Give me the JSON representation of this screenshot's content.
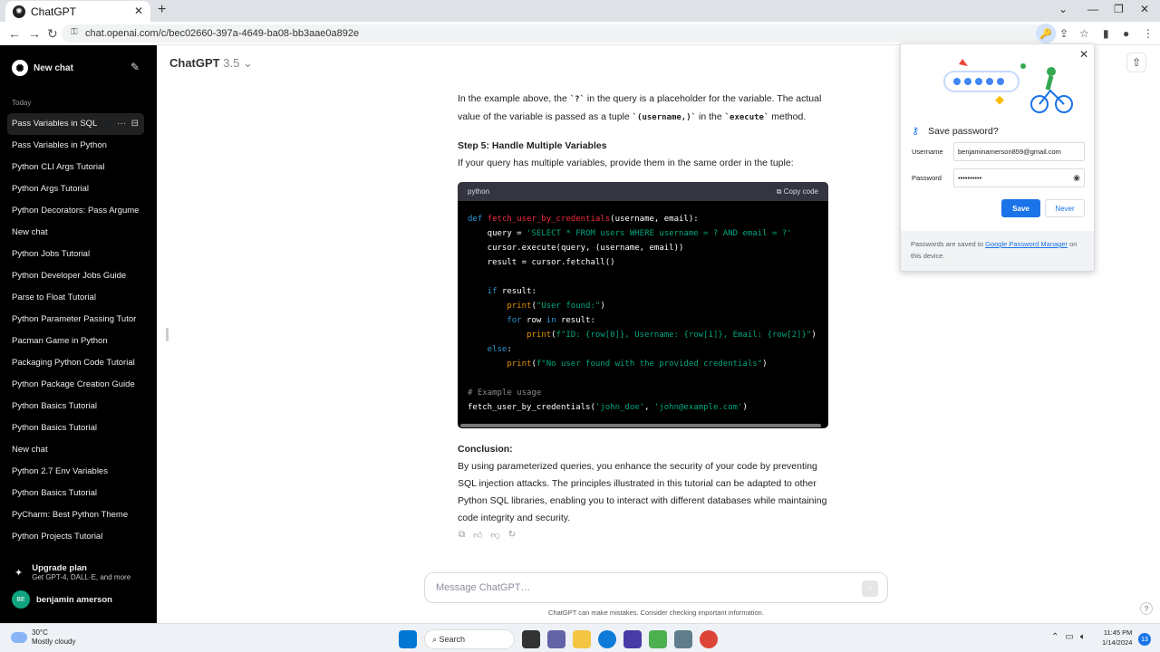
{
  "browser": {
    "tab_title": "ChatGPT",
    "url": "chat.openai.com/c/bec02660-397a-4649-ba08-bb3aae0a892e"
  },
  "sidebar": {
    "new_chat": "New chat",
    "section_today": "Today",
    "items": [
      {
        "label": "Pass Variables in SQL"
      },
      {
        "label": "Pass Variables in Python"
      },
      {
        "label": "Python CLI Args Tutorial"
      },
      {
        "label": "Python Args Tutorial"
      },
      {
        "label": "Python Decorators: Pass Argume"
      },
      {
        "label": "New chat"
      },
      {
        "label": "Python Jobs Tutorial"
      },
      {
        "label": "Python Developer Jobs Guide"
      },
      {
        "label": "Parse to Float Tutorial"
      },
      {
        "label": "Python Parameter Passing Tutor"
      },
      {
        "label": "Pacman Game in Python"
      },
      {
        "label": "Packaging Python Code Tutorial"
      },
      {
        "label": "Python Package Creation Guide"
      },
      {
        "label": "Python Basics Tutorial"
      },
      {
        "label": "Python Basics Tutorial"
      },
      {
        "label": "New chat"
      },
      {
        "label": "Python 2.7 Env Variables"
      },
      {
        "label": "Python Basics Tutorial"
      },
      {
        "label": "PyCharm: Best Python Theme"
      },
      {
        "label": "Python Projects Tutorial"
      }
    ],
    "upgrade_title": "Upgrade plan",
    "upgrade_sub": "Get GPT-4, DALL·E, and more",
    "user_initials": "BE",
    "user_name": "benjamin amerson"
  },
  "header": {
    "model": "ChatGPT",
    "version": "3.5"
  },
  "message": {
    "para1_a": "In the example above, the ",
    "para1_code1": "`?`",
    "para1_b": " in the query is a placeholder for the variable. The actual value of the variable is passed as a tuple ",
    "para1_code2": "`(username,)`",
    "para1_c": " in the ",
    "para1_code3": "`execute`",
    "para1_d": " method.",
    "step5_title": "Step 5: Handle Multiple Variables",
    "step5_text": "If your query has multiple variables, provide them in the same order in the tuple:",
    "code_lang": "python",
    "copy_label": "Copy code",
    "conclusion_title": "Conclusion:",
    "conclusion_text": "By using parameterized queries, you enhance the security of your code by preventing SQL injection attacks. The principles illustrated in this tutorial can be adapted to other Python SQL libraries, enabling you to interact with different databases while maintaining code integrity and security."
  },
  "code": {
    "l1_def": "def ",
    "l1_fn": "fetch_user_by_credentials",
    "l1_rest": "(username, email):",
    "l2_a": "    query = ",
    "l2_s": "'SELECT * FROM users WHERE username = ? AND email = ?'",
    "l3": "    cursor.execute(query, (username, email))",
    "l4": "    result = cursor.fetchall()",
    "l6_kw": "    if",
    "l6_rest": " result:",
    "l7_bi": "        print",
    "l7_a": "(",
    "l7_s": "\"User found:\"",
    "l7_b": ")",
    "l8_kw1": "        for",
    "l8_a": " row ",
    "l8_kw2": "in",
    "l8_b": " result:",
    "l9_bi": "            print",
    "l9_a": "(",
    "l9_s": "f\"ID: {row[0]}, Username: {row[1]}, Email: {row[2]}\"",
    "l9_b": ")",
    "l10_kw": "    else",
    "l10_rest": ":",
    "l11_bi": "        print",
    "l11_a": "(",
    "l11_s": "f\"No user found with the provided credentials\"",
    "l11_b": ")",
    "l13_cm": "# Example usage",
    "l14_a": "fetch_user_by_credentials(",
    "l14_s1": "'john_doe'",
    "l14_b": ", ",
    "l14_s2": "'john@example.com'",
    "l14_c": ")"
  },
  "composer": {
    "placeholder": "Message ChatGPT…",
    "disclaimer": "ChatGPT can make mistakes. Consider checking important information."
  },
  "password_popup": {
    "title": "Save password?",
    "username_label": "Username",
    "username_value": "benjaminamerson859@gmail.com",
    "password_label": "Password",
    "password_value": "••••••••••",
    "save": "Save",
    "never": "Never",
    "footer_a": "Passwords are saved to ",
    "footer_link": "Google Password Manager",
    "footer_b": " on this device."
  },
  "taskbar": {
    "temp": "30°C",
    "weather": "Mostly cloudy",
    "search": "Search",
    "time": "11:45 PM",
    "date": "1/14/2024",
    "notifications": "13"
  }
}
